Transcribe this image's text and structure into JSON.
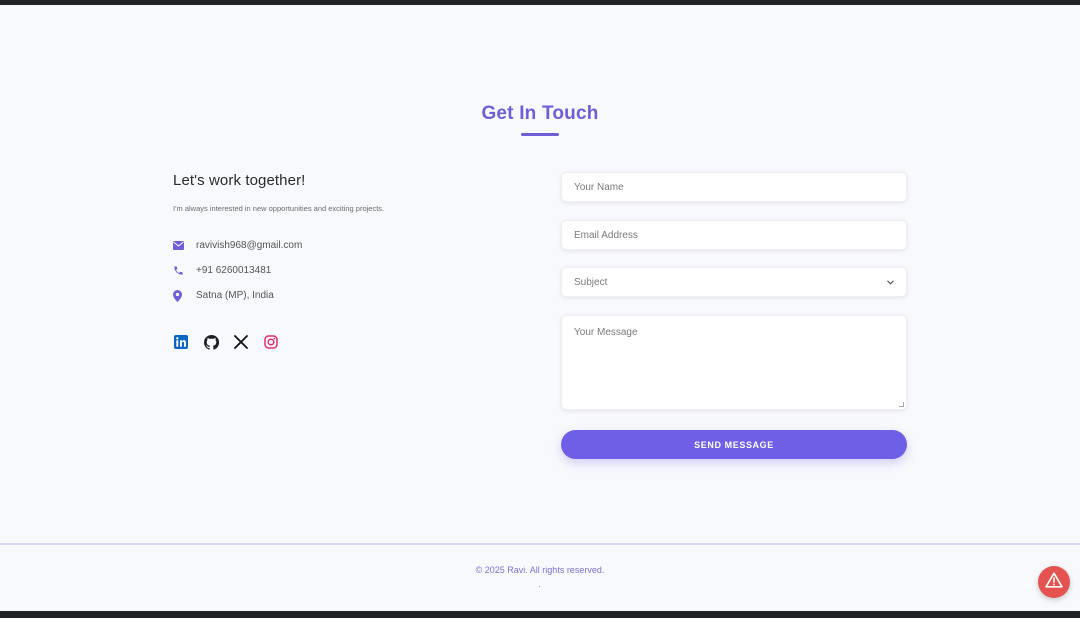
{
  "section": {
    "title": "Get In Touch"
  },
  "contact_info": {
    "heading": "Let's work together!",
    "intro": "I'm always interested in new opportunities and exciting projects.",
    "items": [
      {
        "icon": "envelope-icon",
        "text": "ravivish968@gmail.com"
      },
      {
        "icon": "phone-icon",
        "text": "+91 6260013481"
      },
      {
        "icon": "location-pin-icon",
        "text": "Satna (MP), India"
      }
    ],
    "socials": [
      {
        "icon": "linkedin-icon",
        "color": "#0a66c2"
      },
      {
        "icon": "github-icon",
        "color": "#1b1f23"
      },
      {
        "icon": "x-icon",
        "color": "#111111"
      },
      {
        "icon": "instagram-icon",
        "color": "#e1306c"
      }
    ]
  },
  "form": {
    "name_placeholder": "Your Name",
    "email_placeholder": "Email Address",
    "subject_selected": "Subject",
    "message_placeholder": "Your Message",
    "submit_label": "SEND MESSAGE"
  },
  "footer": {
    "copyright": "© 2025 Ravi. All rights reserved."
  },
  "colors": {
    "accent": "#6e5fe6",
    "alert": "#e4534f"
  }
}
